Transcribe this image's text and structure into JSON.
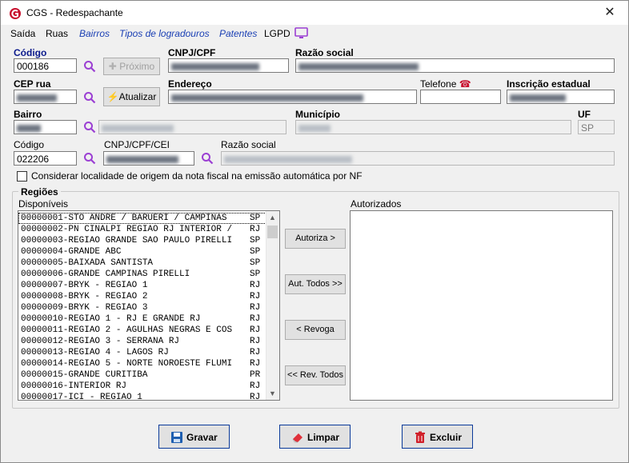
{
  "window": {
    "title": "CGS - Redespachante",
    "close_glyph": "✕"
  },
  "menu": {
    "items": [
      {
        "label": "Saída",
        "style": "plain"
      },
      {
        "label": "Ruas",
        "style": "plain"
      },
      {
        "label": "Bairros",
        "style": "link"
      },
      {
        "label": "Tipos de logradouros",
        "style": "link"
      },
      {
        "label": "Patentes",
        "style": "link"
      },
      {
        "label": "LGPD",
        "style": "plain"
      }
    ]
  },
  "form": {
    "codigo_label": "Código",
    "codigo_value": "000186",
    "proximo_label": "Próximo",
    "cnpj_label": "CNPJ/CPF",
    "razao_label": "Razão social",
    "cep_label": "CEP rua",
    "atualizar_label": "Atualizar",
    "endereco_label": "Endereço",
    "telefone_label": "Telefone",
    "inscricao_label": "Inscrição estadual",
    "bairro_label": "Bairro",
    "municipio_label": "Município",
    "uf_label": "UF",
    "uf_value": "SP",
    "codigo2_label": "Código",
    "codigo2_value": "022206",
    "cnpj2_label": "CNPJ/CPF/CEI",
    "razao2_label": "Razão social",
    "checkbox_label": "Considerar localidade de origem da nota fiscal na emissão automática por NF"
  },
  "regioes": {
    "group_label": "Regiões",
    "disponiveis_label": "Disponíveis",
    "autorizados_label": "Autorizados",
    "items": [
      {
        "text": "00000001-STO ANDRE / BARUERI / CAMPINAS",
        "uf": "SP"
      },
      {
        "text": "00000002-PN CINALPI REGIAO RJ INTERIOR /",
        "uf": "RJ"
      },
      {
        "text": "00000003-REGIAO GRANDE SAO PAULO PIRELLI",
        "uf": "SP"
      },
      {
        "text": "00000004-GRANDE ABC",
        "uf": "SP"
      },
      {
        "text": "00000005-BAIXADA SANTISTA",
        "uf": "SP"
      },
      {
        "text": "00000006-GRANDE CAMPINAS PIRELLI",
        "uf": "SP"
      },
      {
        "text": "00000007-BRYK - REGIAO 1",
        "uf": "RJ"
      },
      {
        "text": "00000008-BRYK - REGIAO 2",
        "uf": "RJ"
      },
      {
        "text": "00000009-BRYK - REGIAO 3",
        "uf": "RJ"
      },
      {
        "text": "00000010-REGIAO 1 - RJ E GRANDE RJ",
        "uf": "RJ"
      },
      {
        "text": "00000011-REGIAO 2 - AGULHAS NEGRAS E COS",
        "uf": "RJ"
      },
      {
        "text": "00000012-REGIAO 3 - SERRANA RJ",
        "uf": "RJ"
      },
      {
        "text": "00000013-REGIAO 4 - LAGOS RJ",
        "uf": "RJ"
      },
      {
        "text": "00000014-REGIAO 5 - NORTE NOROESTE FLUMI",
        "uf": "RJ"
      },
      {
        "text": "00000015-GRANDE CURITIBA",
        "uf": "PR"
      },
      {
        "text": "00000016-INTERIOR RJ",
        "uf": "RJ"
      },
      {
        "text": "00000017-ICI - REGIAO 1",
        "uf": "RJ"
      }
    ],
    "buttons": {
      "autoriza": "Autoriza >",
      "aut_todos": "Aut. Todos >>",
      "revoga": "< Revoga",
      "rev_todos": "<< Rev. Todos"
    }
  },
  "footer": {
    "gravar": "Gravar",
    "limpar": "Limpar",
    "excluir": "Excluir"
  },
  "colors": {
    "accent_navy": "#0b1a8c",
    "link": "#1a3fb4",
    "search_icon": "#9b3fd3",
    "logo": "#c8102e"
  }
}
